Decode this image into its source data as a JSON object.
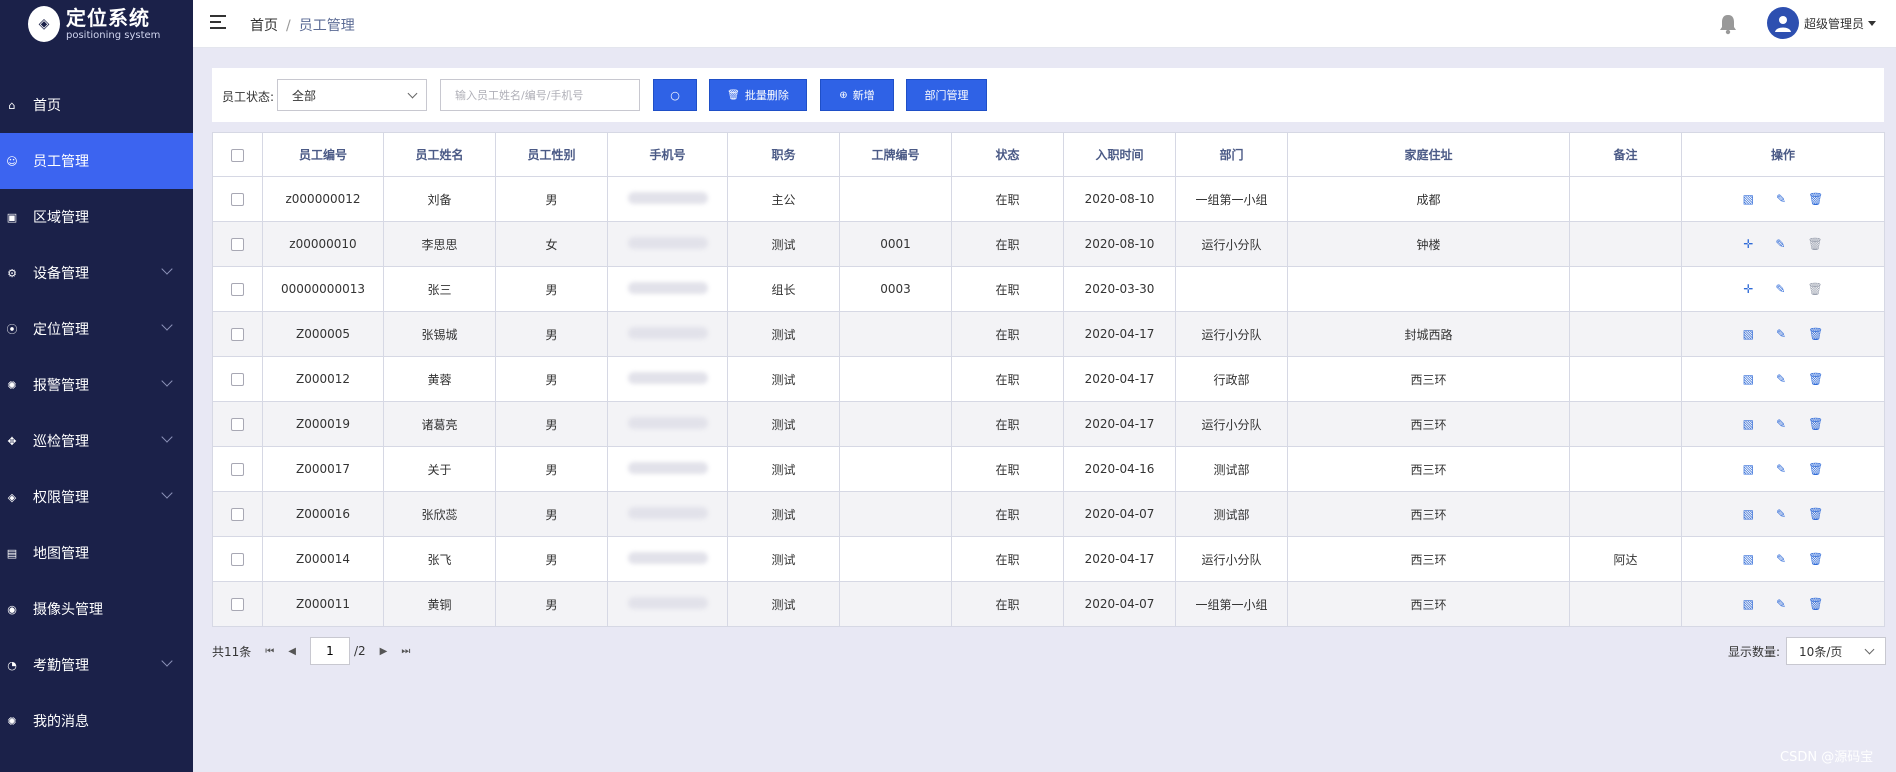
{
  "app": {
    "title": "定位系统",
    "subtitle": "positioning system"
  },
  "sidebar": {
    "items": [
      {
        "label": "首页",
        "icon": "home-icon",
        "glyph": "⌂",
        "arrow": false
      },
      {
        "label": "员工管理",
        "icon": "user-icon",
        "glyph": "☺",
        "arrow": false,
        "active": true
      },
      {
        "label": "区域管理",
        "icon": "area-icon",
        "glyph": "▣",
        "arrow": false
      },
      {
        "label": "设备管理",
        "icon": "gear-icon",
        "glyph": "⚙",
        "arrow": true
      },
      {
        "label": "定位管理",
        "icon": "location-pin-icon",
        "glyph": "⦿",
        "arrow": true
      },
      {
        "label": "报警管理",
        "icon": "alarm-icon",
        "glyph": "✺",
        "arrow": true
      },
      {
        "label": "巡检管理",
        "icon": "patrol-icon",
        "glyph": "✥",
        "arrow": true
      },
      {
        "label": "权限管理",
        "icon": "shield-icon",
        "glyph": "◈",
        "arrow": true
      },
      {
        "label": "地图管理",
        "icon": "map-icon",
        "glyph": "▤",
        "arrow": false
      },
      {
        "label": "摄像头管理",
        "icon": "camera-icon",
        "glyph": "◉",
        "arrow": false
      },
      {
        "label": "考勤管理",
        "icon": "clock-icon",
        "glyph": "◔",
        "arrow": true
      },
      {
        "label": "我的消息",
        "icon": "message-icon",
        "glyph": "✺",
        "arrow": false
      }
    ]
  },
  "header": {
    "breadcrumb": {
      "home": "首页",
      "sep": "/",
      "current": "员工管理"
    },
    "user": {
      "name": "超级管理员"
    }
  },
  "filter": {
    "status_label": "员工状态:",
    "status_value": "全部",
    "search_placeholder": "输入员工姓名/编号/手机号",
    "btn_batch_delete": "批量删除",
    "btn_add": "新增",
    "btn_department": "部门管理"
  },
  "table": {
    "columns": [
      "员工编号",
      "员工姓名",
      "员工性别",
      "手机号",
      "职务",
      "工牌编号",
      "状态",
      "入职时间",
      "部门",
      "家庭住址",
      "备注",
      "操作"
    ],
    "rows": [
      {
        "id": "z000000012",
        "name": "刘备",
        "gender": "男",
        "phone": "",
        "title": "主公",
        "badge": "",
        "status": "在职",
        "date": "2020-08-10",
        "dept": "一组第一小组",
        "address": "成都",
        "note": "",
        "op1": "map"
      },
      {
        "id": "z00000010",
        "name": "李思思",
        "gender": "女",
        "phone": "",
        "title": "测试",
        "badge": "0001",
        "status": "在职",
        "date": "2020-08-10",
        "dept": "运行小分队",
        "address": "钟楼",
        "note": "",
        "op1": "plus"
      },
      {
        "id": "00000000013",
        "name": "张三",
        "gender": "男",
        "phone": "",
        "title": "组长",
        "badge": "0003",
        "status": "在职",
        "date": "2020-03-30",
        "dept": "",
        "address": "",
        "note": "",
        "op1": "plus"
      },
      {
        "id": "Z000005",
        "name": "张锡城",
        "gender": "男",
        "phone": "",
        "title": "测试",
        "badge": "",
        "status": "在职",
        "date": "2020-04-17",
        "dept": "运行小分队",
        "address": "封城西路",
        "note": "",
        "op1": "map"
      },
      {
        "id": "Z000012",
        "name": "黄蓉",
        "gender": "男",
        "phone": "",
        "title": "测试",
        "badge": "",
        "status": "在职",
        "date": "2020-04-17",
        "dept": "行政部",
        "address": "西三环",
        "note": "",
        "op1": "map"
      },
      {
        "id": "Z000019",
        "name": "诸葛亮",
        "gender": "男",
        "phone": "",
        "title": "测试",
        "badge": "",
        "status": "在职",
        "date": "2020-04-17",
        "dept": "运行小分队",
        "address": "西三环",
        "note": "",
        "op1": "map"
      },
      {
        "id": "Z000017",
        "name": "关于",
        "gender": "男",
        "phone": "",
        "title": "测试",
        "badge": "",
        "status": "在职",
        "date": "2020-04-16",
        "dept": "测试部",
        "address": "西三环",
        "note": "",
        "op1": "map"
      },
      {
        "id": "Z000016",
        "name": "张欣蕊",
        "gender": "男",
        "phone": "",
        "title": "测试",
        "badge": "",
        "status": "在职",
        "date": "2020-04-07",
        "dept": "测试部",
        "address": "西三环",
        "note": "",
        "op1": "map"
      },
      {
        "id": "Z000014",
        "name": "张飞",
        "gender": "男",
        "phone": "",
        "title": "测试",
        "badge": "",
        "status": "在职",
        "date": "2020-04-17",
        "dept": "运行小分队",
        "address": "西三环",
        "note": "阿达",
        "op1": "map"
      },
      {
        "id": "Z000011",
        "name": "黄铜",
        "gender": "男",
        "phone": "",
        "title": "测试",
        "badge": "",
        "status": "在职",
        "date": "2020-04-07",
        "dept": "一组第一小组",
        "address": "西三环",
        "note": "",
        "op1": "map"
      }
    ]
  },
  "pagination": {
    "total": "共11条",
    "page": "1",
    "pages": "/2",
    "size_label": "显示数量:",
    "size_value": "10条/页"
  },
  "watermark": "CSDN @源码宝",
  "colors": {
    "sidebar": "#1b2149",
    "accent": "#3c64f0",
    "button": "#2f62e6",
    "op_icon": "#2e6ad8"
  }
}
